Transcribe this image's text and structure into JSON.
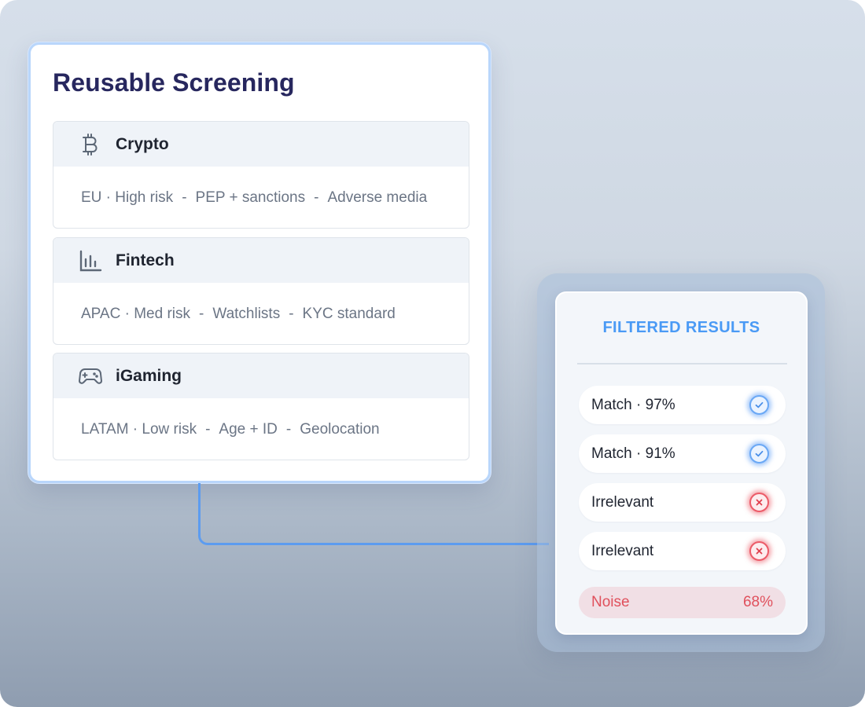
{
  "screening": {
    "title": "Reusable Screening",
    "segments": [
      {
        "name": "Crypto",
        "icon": "bitcoin-icon",
        "tags": [
          "EU · High risk",
          "PEP + sanctions",
          "Adverse media"
        ]
      },
      {
        "name": "Fintech",
        "icon": "bar-chart-icon",
        "tags": [
          "APAC · Med risk",
          "Watchlists",
          "KYC standard"
        ]
      },
      {
        "name": "iGaming",
        "icon": "gamepad-icon",
        "tags": [
          "LATAM · Low risk",
          "Age + ID",
          "Geolocation"
        ]
      }
    ],
    "separator": "-"
  },
  "results": {
    "title": "FILTERED RESULTS",
    "rows": [
      {
        "label": "Match · 97%",
        "status": "check"
      },
      {
        "label": "Match · 91%",
        "status": "check"
      },
      {
        "label": "Irrelevant",
        "status": "cross"
      },
      {
        "label": "Irrelevant",
        "status": "cross"
      }
    ],
    "noise": {
      "label": "Noise",
      "value": "68%"
    }
  },
  "colors": {
    "title": "#27275e",
    "accent_blue": "#4a9af5",
    "connector": "#5c9cf0",
    "match": "#6aa8f5",
    "irrelevant": "#ec5b68",
    "noise_text": "#e0505c",
    "noise_bg": "#f1dfe5"
  }
}
